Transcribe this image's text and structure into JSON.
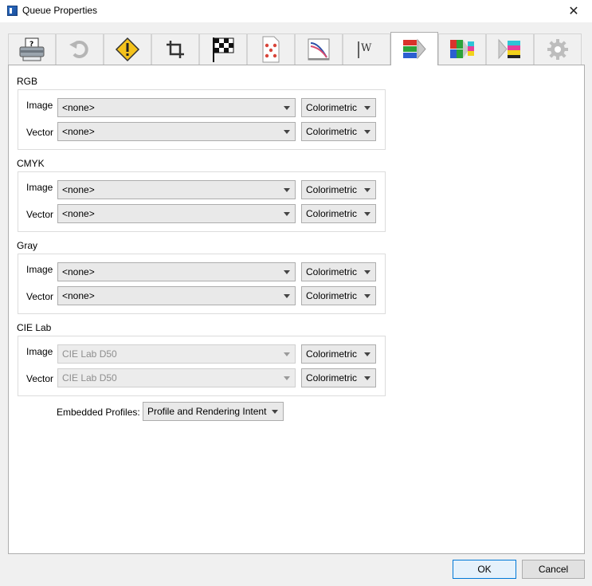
{
  "window": {
    "title": "Queue Properties"
  },
  "tabs": [
    {
      "name": "printer-tab",
      "icon": "printer-icon"
    },
    {
      "name": "rotate-tab",
      "icon": "rotate-icon"
    },
    {
      "name": "warning-tab",
      "icon": "warning-icon"
    },
    {
      "name": "crop-tab",
      "icon": "crop-icon"
    },
    {
      "name": "checkered-flag-tab",
      "icon": "checkered-flag-icon"
    },
    {
      "name": "dice-page-tab",
      "icon": "page-dots-icon"
    },
    {
      "name": "curve-page-tab",
      "icon": "curve-page-icon"
    },
    {
      "name": "watermark-tab",
      "icon": "watermark-icon"
    },
    {
      "name": "color-management-tab",
      "icon": "color-bars-icon",
      "active": true
    },
    {
      "name": "color-convert-tab",
      "icon": "color-convert-icon"
    },
    {
      "name": "color-output-tab",
      "icon": "color-output-icon"
    },
    {
      "name": "settings-tab",
      "icon": "gear-icon"
    }
  ],
  "groups": {
    "rgb": {
      "label": "RGB",
      "image": {
        "label": "Image",
        "value": "<none>",
        "intent": "Colorimetric"
      },
      "vector": {
        "label": "Vector",
        "value": "<none>",
        "intent": "Colorimetric"
      }
    },
    "cmyk": {
      "label": "CMYK",
      "image": {
        "label": "Image",
        "value": "<none>",
        "intent": "Colorimetric"
      },
      "vector": {
        "label": "Vector",
        "value": "<none>",
        "intent": "Colorimetric"
      }
    },
    "gray": {
      "label": "Gray",
      "image": {
        "label": "Image",
        "value": "<none>",
        "intent": "Colorimetric"
      },
      "vector": {
        "label": "Vector",
        "value": "<none>",
        "intent": "Colorimetric"
      }
    },
    "cielab": {
      "label": "CIE Lab",
      "image": {
        "label": "Image",
        "value": "CIE Lab D50",
        "intent": "Colorimetric"
      },
      "vector": {
        "label": "Vector",
        "value": "CIE Lab D50",
        "intent": "Colorimetric"
      }
    }
  },
  "embedded": {
    "label": "Embedded Profiles:",
    "value": "Profile and Rendering Intent"
  },
  "buttons": {
    "ok": "OK",
    "cancel": "Cancel"
  },
  "colors": {
    "accent": "#0078d7",
    "panel": "#ffffff",
    "chrome": "#f0f0f0"
  }
}
